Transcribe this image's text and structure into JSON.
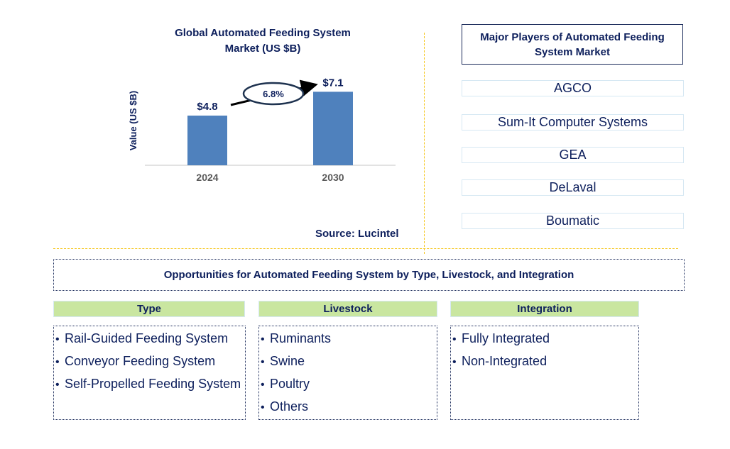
{
  "chart_data": {
    "type": "bar",
    "title": "Global Automated Feeding System Market (US $B)",
    "title_lines": [
      "Global Automated Feeding System",
      "Market (US $B)"
    ],
    "categories": [
      "2024",
      "2030"
    ],
    "values": [
      4.8,
      7.1
    ],
    "data_labels": [
      "$4.8",
      "$7.1"
    ],
    "xlabel": "",
    "ylabel": "Value (US $B)",
    "ylim": [
      0,
      7.4
    ],
    "grid": false,
    "bar_color": "#4f81bd",
    "annotation": {
      "text": "6.8%",
      "meaning": "CAGR 2024-2030",
      "style": "ellipse with arrow"
    },
    "source": "Source: Lucintel"
  },
  "players": {
    "title": "Major Players of Automated Feeding System Market",
    "items": [
      "AGCO",
      "Sum-It Computer Systems",
      "GEA",
      "DeLaval",
      "Boumatic"
    ]
  },
  "opportunities": {
    "title": "Opportunities for Automated Feeding System by Type, Livestock, and Integration",
    "categories": [
      {
        "header": "Type",
        "items": [
          "Rail-Guided Feeding System",
          "Conveyor Feeding System",
          "Self-Propelled Feeding System"
        ]
      },
      {
        "header": "Livestock",
        "items": [
          "Ruminants",
          "Swine",
          "Poultry",
          "Others"
        ]
      },
      {
        "header": "Integration",
        "items": [
          "Fully Integrated",
          "Non-Integrated"
        ]
      }
    ]
  },
  "colors": {
    "text_navy": "#0d1f5c",
    "bar_blue": "#4f81bd",
    "header_green": "#c9e6a0",
    "divider_yellow": "#f5c518",
    "player_border": "#d6e8f3"
  },
  "bullet": "•"
}
